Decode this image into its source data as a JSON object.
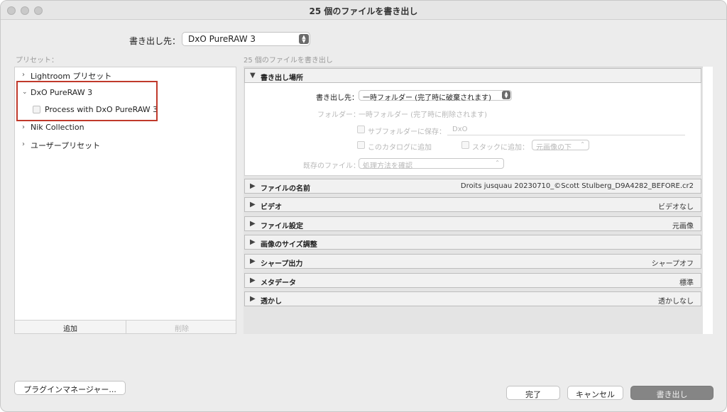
{
  "window": {
    "title": "25 個のファイルを書き出し"
  },
  "export_target": {
    "label": "書き出し先：",
    "value": "DxO PureRAW 3"
  },
  "presets": {
    "label": "プリセット：",
    "items": [
      {
        "label": "Lightroom プリセット",
        "expanded": false
      },
      {
        "label": "DxO PureRAW 3",
        "expanded": true
      },
      {
        "label": "Process with DxO PureRAW 3",
        "child": true
      },
      {
        "label": "Nik Collection",
        "expanded": false
      },
      {
        "label": "ユーザープリセット",
        "expanded": false
      }
    ],
    "add_label": "追加",
    "remove_label": "削除"
  },
  "right": {
    "header": "25 個のファイルを書き出し",
    "location": {
      "title": "書き出し場所",
      "export_to_label": "書き出し先：",
      "export_to_value": "一時フォルダー (完了時に破棄されます)",
      "folder_label": "フォルダー：",
      "folder_value": "一時フォルダー (完了時に削除されます)",
      "subfolder_label": "サブフォルダーに保存：",
      "subfolder_value": "DxO",
      "catalog_label": "このカタログに追加",
      "stack_label": "スタックに追加：",
      "stack_value": "元画像の下",
      "existing_label": "既存のファイル：",
      "existing_value": "処理方法を確認"
    },
    "sections": [
      {
        "name": "ファイルの名前",
        "value": "Droits jusquau 20230710_©Scott Stulberg_D9A4282_BEFORE.cr2"
      },
      {
        "name": "ビデオ",
        "value": "ビデオなし"
      },
      {
        "name": "ファイル設定",
        "value": "元画像"
      },
      {
        "name": "画像のサイズ調整",
        "value": ""
      },
      {
        "name": "シャープ出力",
        "value": "シャープオフ"
      },
      {
        "name": "メタデータ",
        "value": "標準"
      },
      {
        "name": "透かし",
        "value": "透かしなし"
      }
    ]
  },
  "footer": {
    "plugin_manager": "プラグインマネージャー...",
    "done": "完了",
    "cancel": "キャンセル",
    "export": "書き出し"
  },
  "icons": {
    "collapsed": "chevron-right-icon",
    "expanded": "chevron-down-icon",
    "section_closed": "triangle-right-icon",
    "section_open": "triangle-down-icon"
  }
}
